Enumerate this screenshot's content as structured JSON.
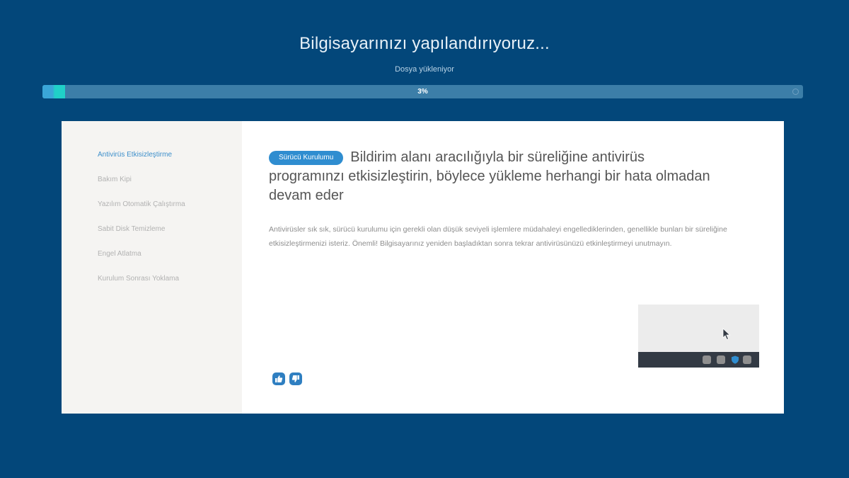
{
  "header": {
    "title": "Bilgisayarınızı yapılandırıyoruz...",
    "status": "Dosya yükleniyor"
  },
  "progress": {
    "label": "3%",
    "value": 0.03,
    "fill_color": "#20d0c8"
  },
  "sidebar": {
    "items": [
      {
        "label": "Antivirüs Etkisizleştirme",
        "active": true
      },
      {
        "label": "Bakım Kipi",
        "active": false
      },
      {
        "label": "Yazılım Otomatik Çalıştırma",
        "active": false
      },
      {
        "label": "Sabit Disk Temizleme",
        "active": false
      },
      {
        "label": "Engel Atlatma",
        "active": false
      },
      {
        "label": "Kurulum Sonrası Yoklama",
        "active": false
      }
    ]
  },
  "main": {
    "badge": "Sürücü Kurulumu",
    "heading": "Bildirim alanı aracılığıyla bir süreliğine antivirüs programınzı etkisizleştirin, böylece yükleme herhangi bir hata olmadan devam eder",
    "description": "Antivirüsler sık sık, sürücü kurulumu için gerekli olan düşük seviyeli işlemlere müdahaleyi engellediklerinden, genellikle bunları bir süreliğine etkisizleştirmenizi isteriz. Önemli! Bilgisayarınız yeniden başladıktan sonra tekrar antivirüsünüzü etkinleştirmeyi unutmayın."
  },
  "feedback": {
    "like_icon": "thumbs-up-icon",
    "dislike_icon": "thumbs-down-icon"
  },
  "colors": {
    "background": "#03477a",
    "accent": "#2f8dd0",
    "active_item": "#3d8fcb"
  }
}
